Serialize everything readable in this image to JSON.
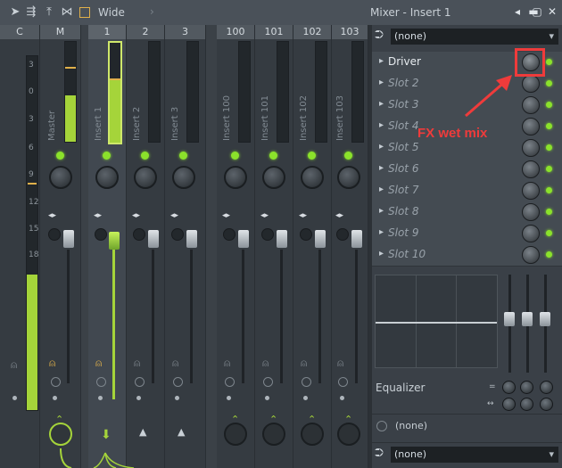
{
  "toolbar": {
    "view_label": "Wide",
    "window_title": "Mixer - Insert 1",
    "icons": [
      "cursor-icon",
      "routing-icon",
      "export-icon",
      "link-icon",
      "square-icon"
    ]
  },
  "strips": [
    {
      "id": "C",
      "label": ""
    },
    {
      "id": "M",
      "label": "Master"
    },
    {
      "id": "1",
      "label": "Insert 1"
    },
    {
      "id": "2",
      "label": "Insert 2"
    },
    {
      "id": "3",
      "label": "Insert 3"
    },
    {
      "id": "100",
      "label": "Insert 100"
    },
    {
      "id": "101",
      "label": "Insert 101"
    },
    {
      "id": "102",
      "label": "Insert 102"
    },
    {
      "id": "103",
      "label": "Insert 103"
    }
  ],
  "db_scale": [
    "3",
    "0",
    "3",
    "6",
    "9",
    "12",
    "15",
    "18"
  ],
  "panel": {
    "input_select": "(none)",
    "slots": [
      {
        "name": "Driver",
        "active": true
      },
      {
        "name": "Slot 2",
        "active": false
      },
      {
        "name": "Slot 3",
        "active": false
      },
      {
        "name": "Slot 4",
        "active": false
      },
      {
        "name": "Slot 5",
        "active": false
      },
      {
        "name": "Slot 6",
        "active": false
      },
      {
        "name": "Slot 7",
        "active": false
      },
      {
        "name": "Slot 8",
        "active": false
      },
      {
        "name": "Slot 9",
        "active": false
      },
      {
        "name": "Slot 10",
        "active": false
      }
    ],
    "equalizer_label": "Equalizer",
    "delay_select": "(none)",
    "output_select": "(none)"
  },
  "annotation": {
    "text": "FX wet mix",
    "color": "#ef3b3b"
  },
  "colors": {
    "accent": "#a5d43a",
    "led": "#8be22b",
    "background": "#3a4047"
  }
}
